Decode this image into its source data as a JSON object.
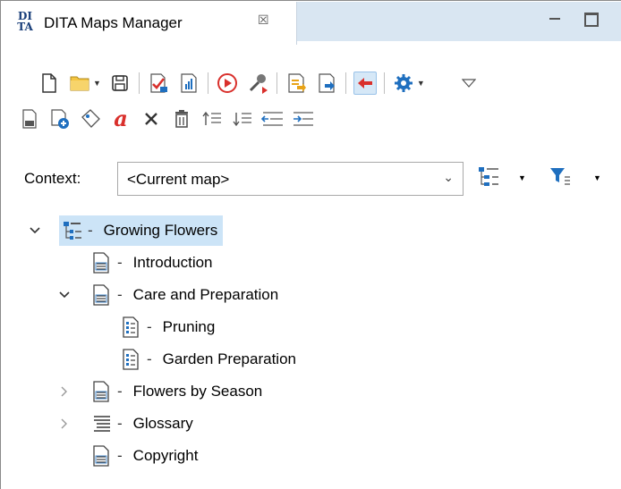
{
  "tab": {
    "logo_text": "DI\nTA",
    "title": "DITA Maps Manager",
    "close_glyph": "☒"
  },
  "toolbar": {
    "row1": [
      "new-file-icon",
      "open-folder-icon",
      "save-icon",
      "validate-icon",
      "report-icon",
      "transform-run-icon",
      "configure-transform-icon",
      "open-in-editor-icon",
      "link-out-icon",
      "link-in-icon",
      "settings-icon",
      "view-menu-icon"
    ],
    "row2": [
      "insert-topic-icon",
      "insert-reference-icon",
      "insert-keydef-icon",
      "rename-icon",
      "delete-icon",
      "remove-icon",
      "move-up-icon",
      "move-down-icon",
      "promote-icon",
      "demote-icon"
    ]
  },
  "context": {
    "label": "Context:",
    "value": "<Current map>"
  },
  "tree": {
    "nodes": [
      {
        "label": "Growing Flowers",
        "level": 0,
        "twisty": "expanded",
        "icon": "map-icon",
        "selected": true
      },
      {
        "label": "Introduction",
        "level": 1,
        "twisty": "none",
        "icon": "topic-icon",
        "selected": false
      },
      {
        "label": "Care and Preparation",
        "level": 1,
        "twisty": "expanded",
        "icon": "topic-icon",
        "selected": false
      },
      {
        "label": "Pruning",
        "level": 2,
        "twisty": "none",
        "icon": "task-icon",
        "selected": false
      },
      {
        "label": "Garden Preparation",
        "level": 2,
        "twisty": "none",
        "icon": "task-icon",
        "selected": false
      },
      {
        "label": "Flowers by Season",
        "level": 1,
        "twisty": "collapsed",
        "icon": "topic-icon",
        "selected": false
      },
      {
        "label": "Glossary",
        "level": 1,
        "twisty": "collapsed",
        "icon": "glossary-icon",
        "selected": false
      },
      {
        "label": "Copyright",
        "level": 1,
        "twisty": "none",
        "icon": "topic-icon",
        "selected": false
      }
    ]
  },
  "colors": {
    "tab_bar": "#d9e6f2",
    "selection": "#cce4f7",
    "accent_blue": "#1f6fbf",
    "accent_red": "#d9302c",
    "accent_orange": "#e8a317"
  }
}
